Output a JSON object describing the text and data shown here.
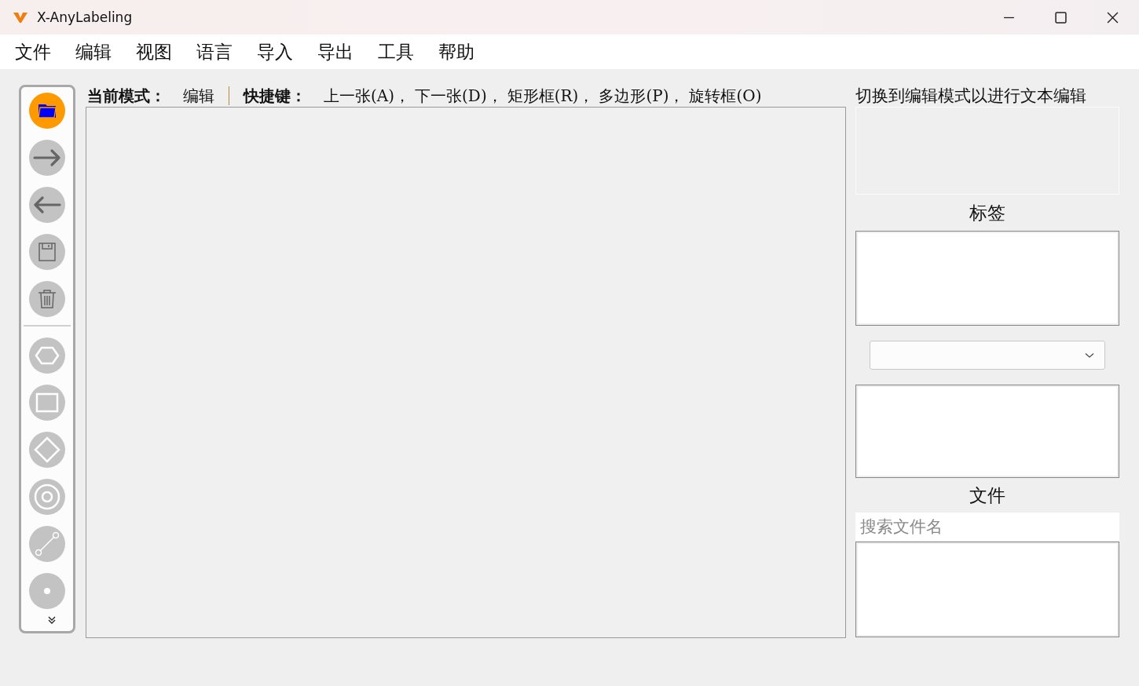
{
  "window": {
    "title": "X-AnyLabeling"
  },
  "menu": [
    "文件",
    "编辑",
    "视图",
    "语言",
    "导入",
    "导出",
    "工具",
    "帮助"
  ],
  "toolbar": {
    "file_tools": [
      {
        "kind": "open",
        "selected": true
      },
      {
        "kind": "next",
        "selected": false
      },
      {
        "kind": "prev",
        "selected": false
      },
      {
        "kind": "save",
        "selected": false
      },
      {
        "kind": "delete",
        "selected": false
      }
    ],
    "shape_tools": [
      {
        "kind": "polygon",
        "selected": false
      },
      {
        "kind": "rectangle",
        "selected": false
      },
      {
        "kind": "rotation",
        "selected": false
      },
      {
        "kind": "circle",
        "selected": false
      },
      {
        "kind": "line",
        "selected": false
      },
      {
        "kind": "point",
        "selected": false
      }
    ]
  },
  "status": {
    "mode_label": "当前模式：",
    "mode": "编辑",
    "shortcut_label": "快捷键：",
    "shortcuts": [
      "上一张(A)，",
      "下一张(D)，",
      "矩形框(R)，",
      "多边形(P)，",
      "旋转框(O)"
    ]
  },
  "description": {
    "hint": "切换到编辑模式以进行文本编辑"
  },
  "labels_panel": {
    "title": "标签"
  },
  "files_panel": {
    "title": "文件",
    "search": {
      "placeholder": "搜索文件名"
    }
  }
}
